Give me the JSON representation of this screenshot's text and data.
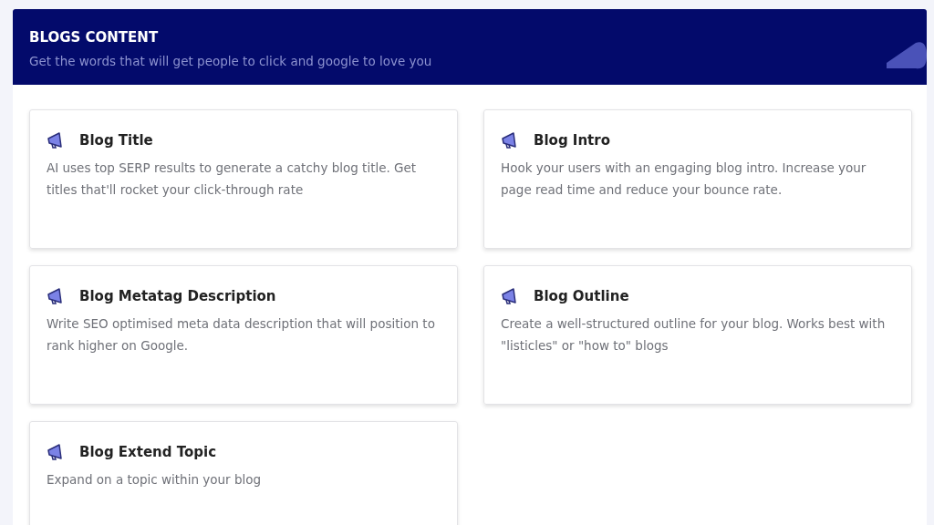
{
  "header": {
    "title": "BLOGS CONTENT",
    "subtitle": "Get the words that will get people to click and google to love you"
  },
  "cards": [
    {
      "title": "Blog Title",
      "description": "AI uses top SERP results to generate a catchy blog title. Get titles that'll rocket your click-through rate"
    },
    {
      "title": "Blog Intro",
      "description": "Hook your users with an engaging blog intro. Increase your page read time and reduce your bounce rate."
    },
    {
      "title": "Blog Metatag Description",
      "description": "Write SEO optimised meta data description that will position to rank higher on Google."
    },
    {
      "title": "Blog Outline",
      "description": "Create a well-structured outline for your blog. Works best with \"listicles\" or \"how to\" blogs"
    },
    {
      "title": "Blog Extend Topic",
      "description": "Expand on a topic within your blog"
    }
  ]
}
